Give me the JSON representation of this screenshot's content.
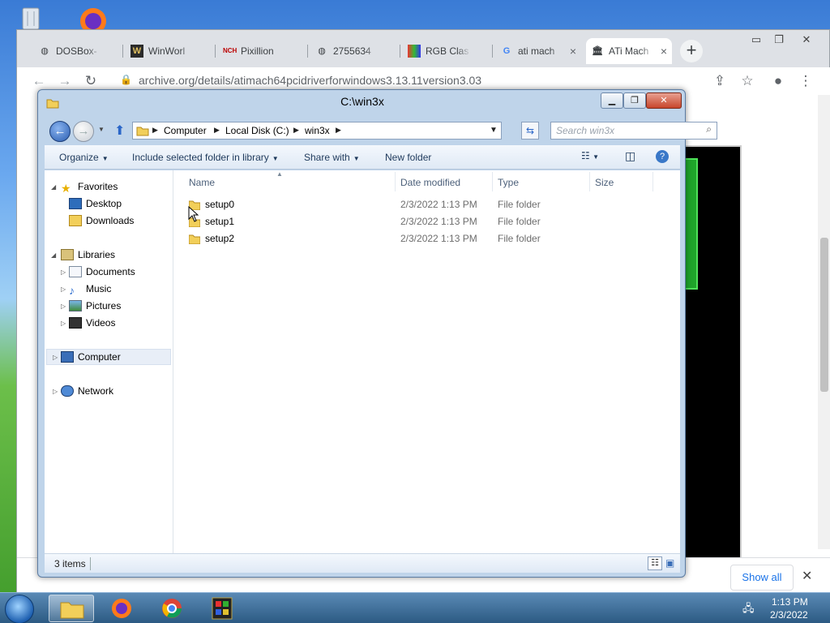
{
  "desktop": {
    "icons": [
      "recycle-bin-icon",
      "firefox-icon"
    ]
  },
  "browser": {
    "tabs": [
      {
        "label": "DOSBox-",
        "icon": "globe-icon",
        "favicon": ""
      },
      {
        "label": "WinWorl",
        "icon": "winworld-icon",
        "favicon": "W"
      },
      {
        "label": "Pixillion",
        "icon": "nch-icon",
        "favicon": "NCH"
      },
      {
        "label": "2755634",
        "icon": "globe-icon",
        "favicon": ""
      },
      {
        "label": "RGB Clas",
        "icon": "rgb-icon",
        "favicon": ""
      },
      {
        "label": "ati mach",
        "icon": "google-icon",
        "favicon": "G"
      },
      {
        "label": "ATi Mach",
        "icon": "archive-icon",
        "favicon": ""
      }
    ],
    "active_tab": 6,
    "new_tab_label": "+",
    "url": "archive.org/details/atimach64pcidriverforwindows3.13.11version3.03",
    "download_bar": {
      "show_all": "Show all"
    }
  },
  "explorer": {
    "title": "C:\\win3x",
    "breadcrumb": [
      "Computer",
      "Local Disk (C:)",
      "win3x"
    ],
    "search_placeholder": "Search win3x",
    "commands": {
      "organize": "Organize",
      "include": "Include selected folder in library",
      "share": "Share with",
      "new_folder": "New folder"
    },
    "nav": {
      "favorites": "Favorites",
      "desktop": "Desktop",
      "downloads": "Downloads",
      "libraries": "Libraries",
      "documents": "Documents",
      "music": "Music",
      "pictures": "Pictures",
      "videos": "Videos",
      "computer": "Computer",
      "network": "Network"
    },
    "columns": {
      "name": "Name",
      "date": "Date modified",
      "type": "Type",
      "size": "Size"
    },
    "files": [
      {
        "name": "setup0",
        "date": "2/3/2022 1:13 PM",
        "type": "File folder"
      },
      {
        "name": "setup1",
        "date": "2/3/2022 1:13 PM",
        "type": "File folder"
      },
      {
        "name": "setup2",
        "date": "2/3/2022 1:13 PM",
        "type": "File folder"
      }
    ],
    "status": "3 items"
  },
  "taskbar": {
    "clock_time": "1:13 PM",
    "clock_date": "2/3/2022",
    "apps": [
      "explorer-icon",
      "firefox-icon",
      "chrome-icon",
      "dosbox-icon"
    ]
  }
}
